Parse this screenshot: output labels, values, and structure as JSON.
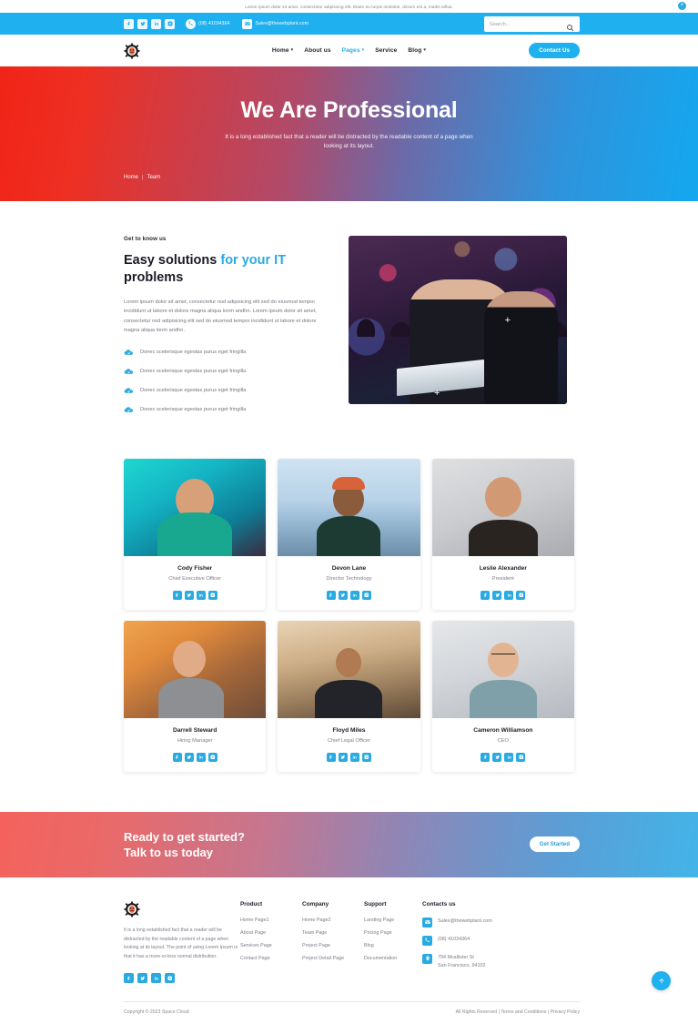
{
  "announce": {
    "text": "Lorem ipsum dolor sit amet, consectetur adipiscing elit. Etiam eu turpis molestie, dictum est a, mattis tellus.",
    "close_label": "×"
  },
  "topbar": {
    "social": [
      "facebook-icon",
      "twitter-icon",
      "linkedin-icon",
      "instagram-icon"
    ],
    "phone": "(08) 41034364",
    "email": "Sales@thewebplant.com"
  },
  "search": {
    "placeholder": "Search...",
    "value": ""
  },
  "nav": {
    "items": [
      {
        "label": "Home",
        "caret": "▾",
        "active": false
      },
      {
        "label": "About us",
        "caret": "",
        "active": false
      },
      {
        "label": "Pages",
        "caret": "▾",
        "active": true
      },
      {
        "label": "Service",
        "caret": "",
        "active": false
      },
      {
        "label": "Blog",
        "caret": "▾",
        "active": false
      }
    ],
    "contact_button": "Contact Us"
  },
  "hero": {
    "title": "We Are Professional",
    "subtitle": "It is a long established fact that a reader will be distracted by the readable content of a page when looking at its layout.",
    "breadcrumb": {
      "home": "Home",
      "sep": "|",
      "current": "Team"
    }
  },
  "about": {
    "eyebrow": "Get to know us",
    "heading_part1": "Easy solutions ",
    "heading_highlight": "for your IT",
    "heading_part2": "problems",
    "description": "Lorem ipsum dolor sit amet, consectetur nod adipisicing elit sed do eiusmod tempor incididunt ut labore et dolore magna aliqua lonm andhn. Lorem ipsum dolor sit amet, consectetur nod adipisicing elit sed do eiusmod tempor incididunt ut labore et dolore magna aliqua lonm andhn.",
    "features": [
      "Donec scelerisque egestas purus eget fringilla",
      "Donec scelerisque egestas purus eget fringilla",
      "Donec scelerisque egestas purus eget fringilla",
      "Donec scelerisque egestas purus eget fringilla"
    ],
    "image_markers": [
      "+",
      "+"
    ]
  },
  "team": {
    "members": [
      {
        "name": "Cody Fisher",
        "role": "Chief Executive Officer",
        "theme": "p-cody"
      },
      {
        "name": "Devon Lane",
        "role": "Director Technology",
        "theme": "p-devon"
      },
      {
        "name": "Leslie Alexander",
        "role": "President",
        "theme": "p-leslie"
      },
      {
        "name": "Darrell Steward",
        "role": "Hiring Manager",
        "theme": "p-darrell"
      },
      {
        "name": "Floyd Miles",
        "role": "Chief Legal Officer",
        "theme": "p-floyd"
      },
      {
        "name": "Cameron Williamson",
        "role": "CEO",
        "theme": "p-cameron"
      }
    ],
    "social": [
      "facebook-icon",
      "twitter-icon",
      "linkedin-icon",
      "instagram-icon"
    ]
  },
  "cta": {
    "line1": "Ready to get started?",
    "line2": "Talk to us today",
    "button": "Get Started"
  },
  "footer": {
    "about": "It is a long established fact that a reader will be distracted by the readable content of a page when looking at its layout. The point of using Lorem Ipsum is that it has a more-or-less normal distribution.",
    "social": [
      "facebook-icon",
      "twitter-icon",
      "linkedin-icon",
      "instagram-icon"
    ],
    "columns": [
      {
        "title": "Product",
        "links": [
          "Home Page1",
          "About Page",
          "Services Page",
          "Contact Page"
        ]
      },
      {
        "title": "Company",
        "links": [
          "Home Page2",
          "Team Page",
          "Project Page",
          "Project Detail Page"
        ]
      },
      {
        "title": "Support",
        "links": [
          "Landing Page",
          "Pricing Page",
          "Blog",
          "Documentation"
        ]
      }
    ],
    "contacts": {
      "title": "Contacts us",
      "email": "Sales@thewebplant.com",
      "phone": "(08) 41034364",
      "address_line1": "794 Mcallister St",
      "address_line2": "San Francisco, 94102"
    },
    "copyright": "Copyright © 2023 Space Cloud",
    "legal": "All Rights Reserved | Terms and Conditions | Privacy Policy",
    "scroll_top": "scroll-to-top"
  },
  "colors": {
    "accent": "#1fb0ef",
    "accent_light": "#29abe2",
    "hero_from": "#f02417",
    "hero_to": "#13a8ef",
    "text": "#22222c",
    "muted": "#7d7d87"
  }
}
